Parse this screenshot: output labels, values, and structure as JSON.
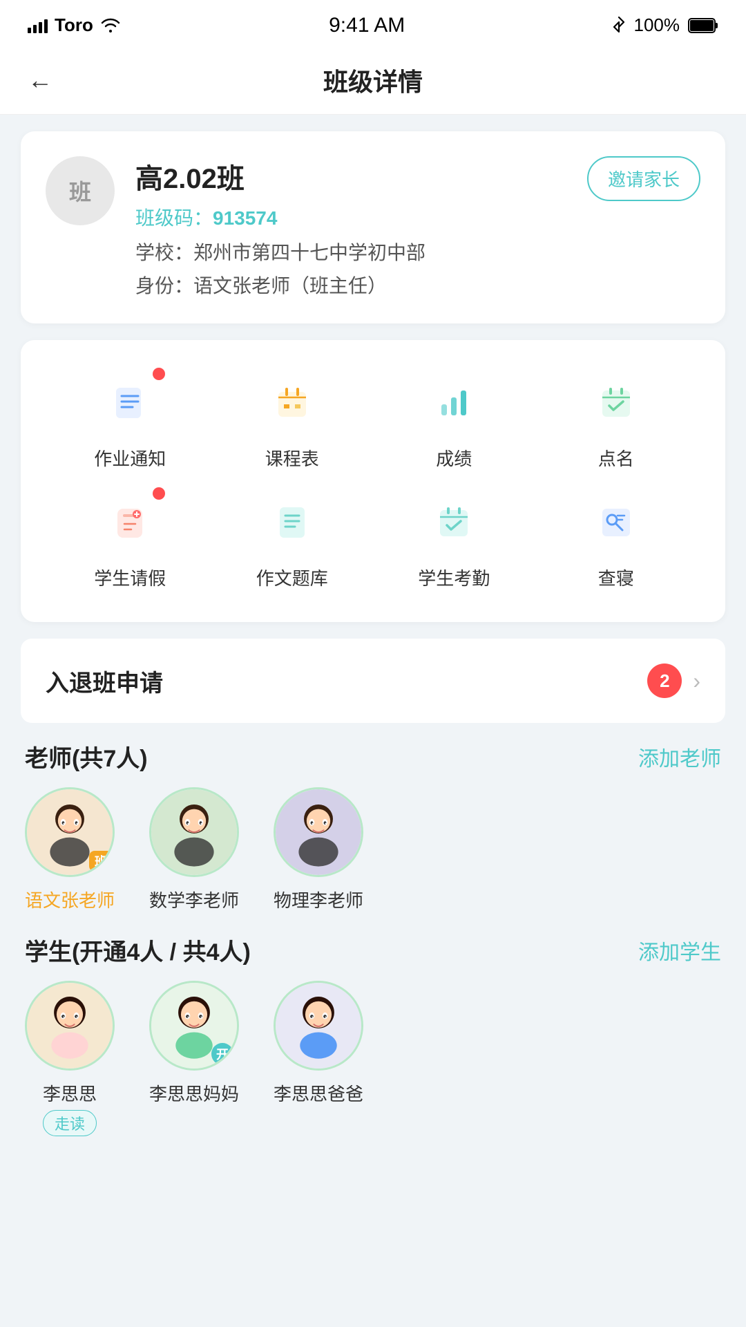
{
  "statusBar": {
    "carrier": "Toro",
    "time": "9:41 AM",
    "bluetooth": "BT",
    "battery": "100%"
  },
  "header": {
    "backLabel": "←",
    "title": "班级详情"
  },
  "classInfo": {
    "avatarLabel": "班",
    "className": "高2.02班",
    "codeLabel": "班级码：",
    "code": "913574",
    "schoolLabel": "学校：",
    "school": "郑州市第四十七中学初中部",
    "roleLabel": "身份：",
    "role": "语文张老师（班主任）",
    "inviteBtn": "邀请家长"
  },
  "menuItems": [
    {
      "id": "homework",
      "label": "作业通知",
      "badge": true,
      "color": "#5b9cf6"
    },
    {
      "id": "schedule",
      "label": "课程表",
      "badge": false,
      "color": "#f5a623"
    },
    {
      "id": "grades",
      "label": "成绩",
      "badge": false,
      "color": "#4ec9c9"
    },
    {
      "id": "rollcall",
      "label": "点名",
      "badge": false,
      "color": "#6dd4a0"
    },
    {
      "id": "leave",
      "label": "学生请假",
      "badge": true,
      "color": "#f5836b"
    },
    {
      "id": "essay",
      "label": "作文题库",
      "badge": false,
      "color": "#6dd4c9"
    },
    {
      "id": "attendance",
      "label": "学生考勤",
      "badge": false,
      "color": "#6dd4c9"
    },
    {
      "id": "dormcheck",
      "label": "查寝",
      "badge": false,
      "color": "#5b9cf6"
    }
  ],
  "admissionSection": {
    "title": "入退班申请",
    "count": "2"
  },
  "teachersSection": {
    "title": "老师(共7人)",
    "addLabel": "添加老师",
    "teachers": [
      {
        "name": "语文张老师",
        "badge": "班",
        "active": true
      },
      {
        "name": "数学李老师",
        "badge": "",
        "active": false
      },
      {
        "name": "物理李老师",
        "badge": "",
        "active": false
      }
    ]
  },
  "studentsSection": {
    "title": "学生(开通4人 / 共4人)",
    "addLabel": "添加学生",
    "students": [
      {
        "name": "李思思",
        "tag": "走读",
        "hasTag": true,
        "hasBadge": false
      },
      {
        "name": "李思思妈妈",
        "tag": "",
        "hasTag": false,
        "hasBadge": true
      },
      {
        "name": "李思思爸爸",
        "tag": "",
        "hasTag": false,
        "hasBadge": false
      }
    ]
  }
}
